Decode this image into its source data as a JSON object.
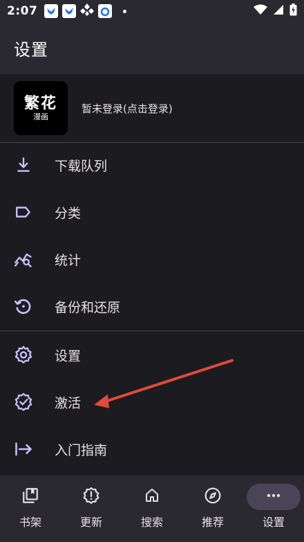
{
  "status_bar": {
    "time": "2:07",
    "notification_icons": [
      "bird-app-icon",
      "bird-app-icon",
      "diamond-app-icon",
      "browser-app-icon"
    ],
    "right_icons": [
      "wifi-icon",
      "signal-icon",
      "battery-icon"
    ]
  },
  "app_bar": {
    "title": "设置"
  },
  "account": {
    "logo_main": "繁花",
    "logo_sub": "漫画",
    "login_text": "暂未登录(点击登录)"
  },
  "menu": {
    "group1": [
      {
        "label": "下载队列",
        "icon": "download-icon"
      },
      {
        "label": "分类",
        "icon": "label-icon"
      },
      {
        "label": "统计",
        "icon": "stats-icon"
      },
      {
        "label": "备份和还原",
        "icon": "backup-restore-icon"
      }
    ],
    "group2": [
      {
        "label": "设置",
        "icon": "gear-icon"
      },
      {
        "label": "激活",
        "icon": "verified-icon"
      },
      {
        "label": "入门指南",
        "icon": "guide-icon"
      }
    ]
  },
  "annotation": {
    "type": "arrow",
    "color": "#e04a3a",
    "points_to": "激活"
  },
  "bottom_nav": {
    "items": [
      {
        "label": "书架",
        "icon": "library-icon",
        "active": false
      },
      {
        "label": "更新",
        "icon": "alert-gear-icon",
        "active": false
      },
      {
        "label": "搜索",
        "icon": "home-icon",
        "active": false
      },
      {
        "label": "推荐",
        "icon": "compass-icon",
        "active": false
      },
      {
        "label": "设置",
        "icon": "more-icon",
        "active": true
      }
    ]
  },
  "colors": {
    "background": "#1c1b1f",
    "surface": "#2b2930",
    "icon_accent": "#c9c0ff",
    "active_pill": "#4a4458",
    "divider": "#49454f"
  }
}
